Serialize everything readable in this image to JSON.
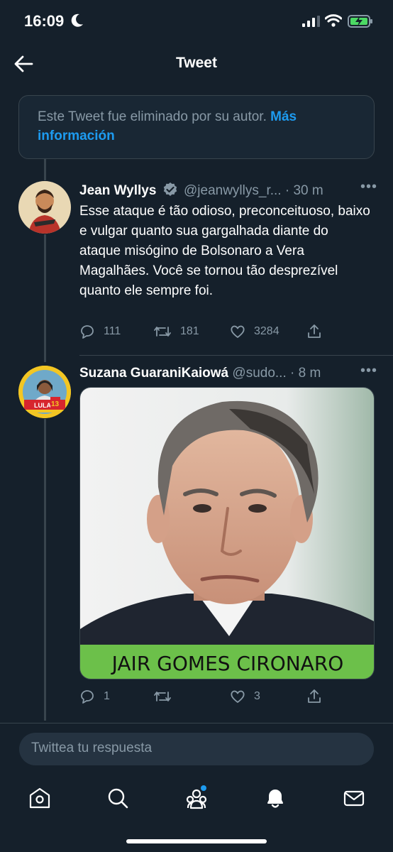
{
  "status_bar": {
    "time": "16:09"
  },
  "header": {
    "title": "Tweet"
  },
  "deleted_notice": {
    "text": "Este Tweet fue eliminado por su autor.",
    "link_label": "Más información"
  },
  "tweets": [
    {
      "name": "Jean Wyllys",
      "verified": true,
      "handle": "@jeanwyllys_r...",
      "time": "· 30 m",
      "text": "Esse ataque é tão odioso, preconceituoso, baixo e vulgar quanto sua gargalhada diante do ataque misógino de Bolsonaro a Vera Magalhães. Você se tornou tão desprezível quanto ele sempre foi.",
      "replies": "111",
      "retweets": "181",
      "likes": "3284"
    },
    {
      "name": "Suzana GuaraniKaiowá",
      "handle": "@sudo...",
      "time": "· 8 m",
      "avatar_badge": "LULA",
      "avatar_badge_number": "13",
      "image_caption": "JAIR GOMES CIRONARO",
      "replies": "1",
      "retweets": "",
      "likes": "3"
    }
  ],
  "reply_box": {
    "placeholder": "Twittea tu respuesta"
  },
  "colors": {
    "background": "#15202b",
    "accent": "#1d9bf0",
    "muted": "#8899a6",
    "border": "#38444d",
    "caption_bg": "#6cc04a"
  },
  "icons": {
    "tab_bar": [
      "home-icon",
      "search-icon",
      "communities-icon",
      "notifications-icon",
      "messages-icon"
    ]
  }
}
